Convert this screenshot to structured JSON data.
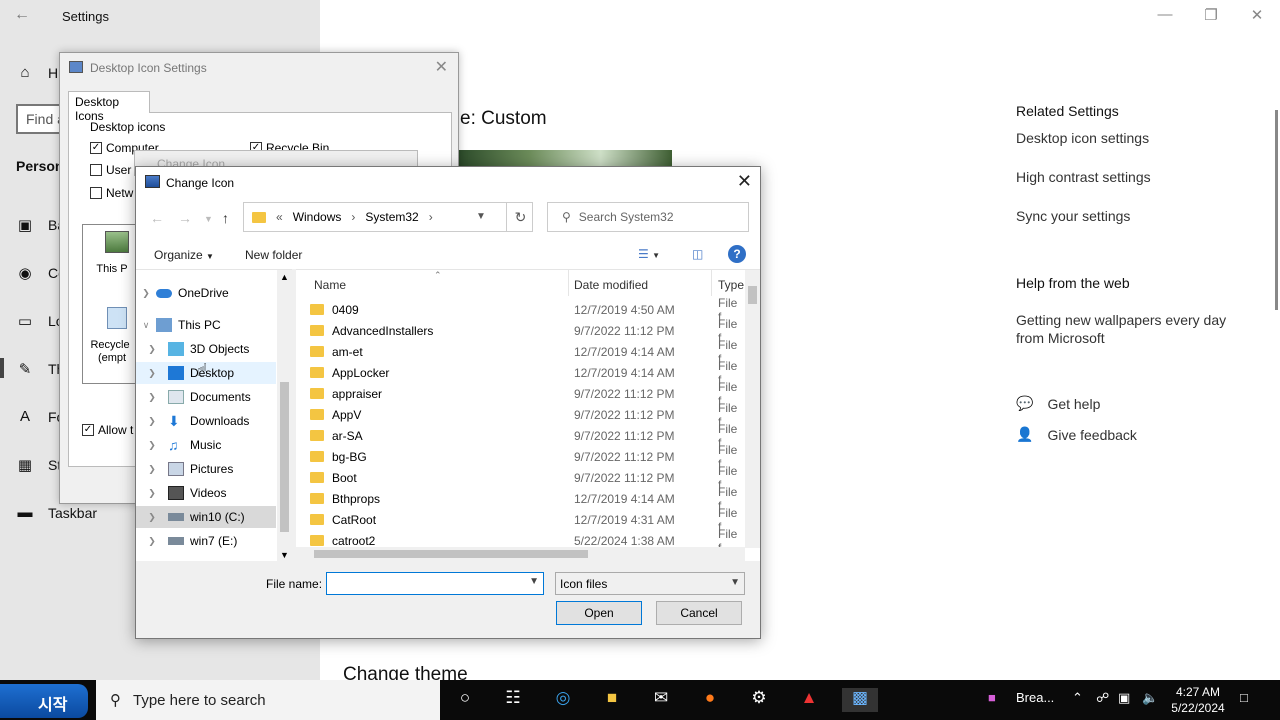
{
  "settings": {
    "title": "Settings",
    "nav": [
      {
        "label": "H",
        "icon": "home-icon"
      },
      {
        "label": "Ba",
        "icon": "picture-icon"
      },
      {
        "label": "Co",
        "icon": "palette-icon"
      },
      {
        "label": "Lo",
        "icon": "lock-screen-icon"
      },
      {
        "label": "Th",
        "icon": "theme-icon"
      },
      {
        "label": "Fo",
        "icon": "font-icon"
      },
      {
        "label": "St",
        "icon": "start-icon"
      },
      {
        "label": "Taskbar",
        "icon": "taskbar-icon"
      }
    ],
    "find_placeholder": "Find a",
    "section": "Person",
    "theme_heading": "e: Custom",
    "change_theme": "Change theme",
    "related_heading": "Related Settings",
    "related_links": [
      "Desktop icon settings",
      "High contrast settings",
      "Sync your settings"
    ],
    "help_heading": "Help from the web",
    "help_link": "Getting new wallpapers every day from Microsoft",
    "get_help": "Get help",
    "give_feedback": "Give feedback"
  },
  "desktop_icon_settings": {
    "title": "Desktop Icon Settings",
    "tab": "Desktop Icons",
    "group": "Desktop icons",
    "checks": [
      {
        "label": "Computer",
        "checked": true
      },
      {
        "label": "Recycle Bin",
        "checked": true
      },
      {
        "label": "User",
        "checked": false
      },
      {
        "label": "Netw",
        "checked": false
      }
    ],
    "icon_labels": [
      "This P",
      "Recycle",
      "(empt"
    ],
    "allow_label": "Allow t"
  },
  "ghost_title": "Change Icon",
  "change_icon": {
    "title": "Change Icon",
    "breadcrumb": [
      "Windows",
      "System32"
    ],
    "search_placeholder": "Search System32",
    "organize": "Organize",
    "new_folder": "New folder",
    "tree": [
      {
        "label": "OneDrive",
        "icon": "onedrive-icon",
        "level": 0
      },
      {
        "label": "This PC",
        "icon": "computer-icon",
        "level": 0,
        "expanded": true
      },
      {
        "label": "3D Objects",
        "icon": "3d-objects-icon",
        "level": 1
      },
      {
        "label": "Desktop",
        "icon": "desktop-icon",
        "level": 1,
        "hover": true
      },
      {
        "label": "Documents",
        "icon": "documents-icon",
        "level": 1
      },
      {
        "label": "Downloads",
        "icon": "downloads-icon",
        "level": 1
      },
      {
        "label": "Music",
        "icon": "music-icon",
        "level": 1
      },
      {
        "label": "Pictures",
        "icon": "pictures-icon",
        "level": 1
      },
      {
        "label": "Videos",
        "icon": "videos-icon",
        "level": 1
      },
      {
        "label": "win10 (C:)",
        "icon": "drive-icon",
        "level": 1,
        "selected": true
      },
      {
        "label": "win7 (E:)",
        "icon": "drive-icon",
        "level": 1
      }
    ],
    "columns": [
      "Name",
      "Date modified",
      "Type"
    ],
    "rows": [
      {
        "name": "0409",
        "date": "12/7/2019 4:50 AM",
        "type": "File f"
      },
      {
        "name": "AdvancedInstallers",
        "date": "9/7/2022 11:12 PM",
        "type": "File f"
      },
      {
        "name": "am-et",
        "date": "12/7/2019 4:14 AM",
        "type": "File f"
      },
      {
        "name": "AppLocker",
        "date": "12/7/2019 4:14 AM",
        "type": "File f"
      },
      {
        "name": "appraiser",
        "date": "9/7/2022 11:12 PM",
        "type": "File f"
      },
      {
        "name": "AppV",
        "date": "9/7/2022 11:12 PM",
        "type": "File f"
      },
      {
        "name": "ar-SA",
        "date": "9/7/2022 11:12 PM",
        "type": "File f"
      },
      {
        "name": "bg-BG",
        "date": "9/7/2022 11:12 PM",
        "type": "File f"
      },
      {
        "name": "Boot",
        "date": "9/7/2022 11:12 PM",
        "type": "File f"
      },
      {
        "name": "Bthprops",
        "date": "12/7/2019 4:14 AM",
        "type": "File f"
      },
      {
        "name": "CatRoot",
        "date": "12/7/2019 4:31 AM",
        "type": "File f"
      },
      {
        "name": "catroot2",
        "date": "5/22/2024 1:38 AM",
        "type": "File f"
      }
    ],
    "file_name_label": "File name:",
    "file_name_value": "",
    "file_type": "Icon files",
    "open": "Open",
    "cancel": "Cancel"
  },
  "taskbar": {
    "start": "시작",
    "search_placeholder": "Type here to search",
    "running_app": "Brea...",
    "time": "4:27 AM",
    "date": "5/22/2024"
  }
}
